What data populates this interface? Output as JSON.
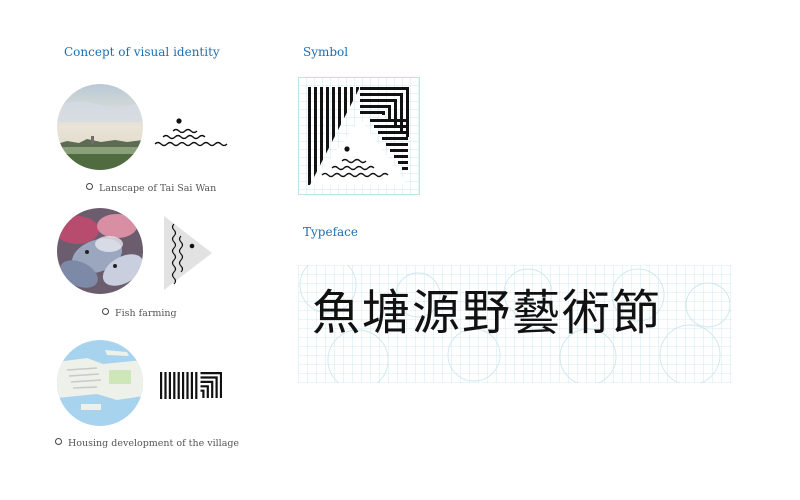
{
  "concept": {
    "title": "Concept of visual identity",
    "items": [
      {
        "caption": "Lanscape of Tai Sai Wan",
        "photo_icon": "landscape-photo",
        "motif_icon": "sun-over-waves-icon"
      },
      {
        "caption": "Fish farming",
        "photo_icon": "fish-farming-photo",
        "motif_icon": "fish-icon"
      },
      {
        "caption": "Housing development of the village",
        "photo_icon": "village-map-photo",
        "motif_icon": "striped-corner-icon"
      }
    ]
  },
  "symbol": {
    "title": "Symbol",
    "icon": "festival-symbol-icon"
  },
  "typeface": {
    "title": "Typeface",
    "text": "魚塘源野藝術節",
    "grid_color": "#bfe3ea"
  },
  "colors": {
    "accent": "#1a6fb5",
    "ink": "#111111"
  }
}
